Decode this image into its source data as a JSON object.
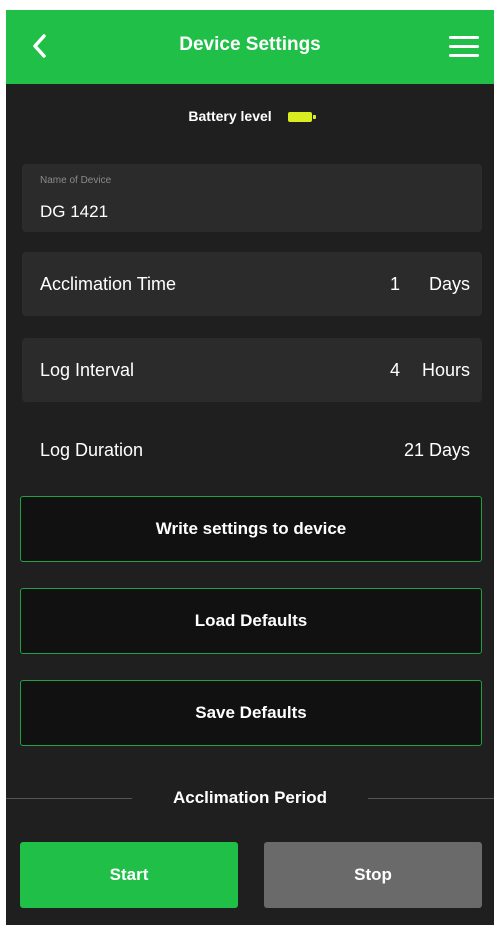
{
  "header": {
    "title": "Device Settings",
    "back_icon": "chevron-left-icon",
    "menu_icon": "hamburger-menu-icon"
  },
  "battery": {
    "label": "Battery level",
    "icon": "battery-icon",
    "color": "#d8ec1f"
  },
  "device_name": {
    "label": "Name of Device",
    "value": "DG 1421"
  },
  "acclimation_time": {
    "label": "Acclimation Time",
    "value": "1",
    "unit": "Days"
  },
  "log_interval": {
    "label": "Log Interval",
    "value": "4",
    "unit": "Hours"
  },
  "log_duration": {
    "label": "Log Duration",
    "value": "21 Days"
  },
  "buttons": {
    "write": "Write settings to device",
    "load": "Load Defaults",
    "save": "Save Defaults"
  },
  "acclimation_period": {
    "title": "Acclimation Period",
    "start": "Start",
    "stop": "Stop"
  },
  "colors": {
    "accent": "#1fbf48",
    "background": "#1f1f1f",
    "field": "#2b2b2b",
    "button_border": "#1fa044",
    "stop_button": "#6a6a6a"
  }
}
